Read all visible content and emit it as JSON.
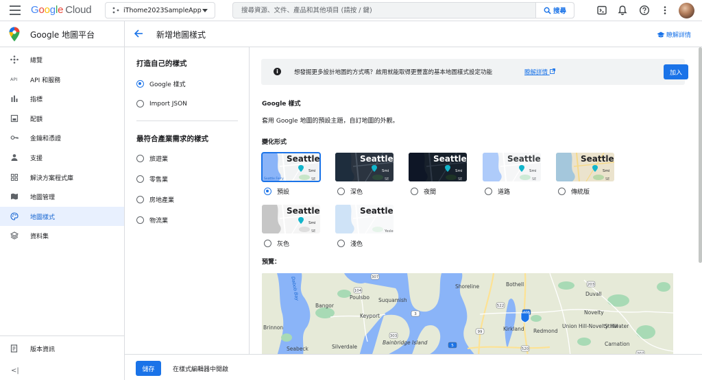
{
  "topbar": {
    "logo_letters": [
      "G",
      "o",
      "o",
      "g",
      "l",
      "e"
    ],
    "logo_cloud": "Cloud",
    "project_name": "iThome2023SampleApp",
    "search_placeholder": "搜尋資源、文件、產品和其他項目 (請按 / 鍵)",
    "search_button": "搜尋"
  },
  "leftnav": {
    "product_title": "Google 地圖平台",
    "items": [
      {
        "label": "總覽",
        "icon": "overview-icon"
      },
      {
        "label": "API 和服務",
        "icon": "api-icon",
        "icon_text": "API"
      },
      {
        "label": "指標",
        "icon": "metrics-icon"
      },
      {
        "label": "配額",
        "icon": "quotas-icon"
      },
      {
        "label": "金鑰和憑證",
        "icon": "key-icon"
      },
      {
        "label": "支援",
        "icon": "support-icon"
      },
      {
        "label": "解決方案程式庫",
        "icon": "library-icon"
      },
      {
        "label": "地圖管理",
        "icon": "map-icon"
      },
      {
        "label": "地圖樣式",
        "icon": "palette-icon"
      },
      {
        "label": "資料集",
        "icon": "dataset-icon"
      }
    ],
    "active_index": 8,
    "release_notes": "版本資訊",
    "collapse": "<|"
  },
  "subheader": {
    "title": "新增地圖樣式",
    "learn_more": "瞭解詳情"
  },
  "style_panel": {
    "section1_title": "打造自己的樣式",
    "section1_options": [
      "Google 樣式",
      "Import JSON"
    ],
    "section1_selected": 0,
    "section2_title": "最符合產業需求的樣式",
    "section2_options": [
      "旅遊業",
      "零售業",
      "房地產業",
      "物流業"
    ]
  },
  "content": {
    "banner_text": "想發掘更多設計地圖的方式嗎？啟用就能取得更豐富的基本地圖樣式設定功能",
    "banner_link": "瞭解詳情",
    "banner_button": "加入",
    "google_style_title": "Google 樣式",
    "google_style_desc": "套用 Google 地圖的預設主題，自訂地圖的外觀。",
    "variants_title": "變化形式",
    "variants": [
      {
        "label": "預設",
        "theme": "default"
      },
      {
        "label": "深色",
        "theme": "dark"
      },
      {
        "label": "夜間",
        "theme": "night"
      },
      {
        "label": "道路",
        "theme": "road"
      },
      {
        "label": "傳統版",
        "theme": "retro"
      },
      {
        "label": "灰色",
        "theme": "gray"
      },
      {
        "label": "淺色",
        "theme": "light"
      }
    ],
    "selected_variant": 0,
    "thumb_city": "Seattle",
    "thumb_road": "SE",
    "thumb_road_alt": "Yesler Wy",
    "thumb_ferry": "Seattle Ferry",
    "thumb_smith": "Smi",
    "preview_title": "預覽：",
    "map_labels": [
      "Shoreline",
      "Bothell",
      "Poulsbo",
      "Suquamish",
      "Bangor",
      "Keyport",
      "Kirkland",
      "Redmond",
      "Union Hill-Novelty Hill",
      "Novelty",
      "Duvall",
      "Stillwater",
      "Carnation",
      "Brinnon",
      "Seabeck",
      "Silverdale",
      "Bainbridge Island",
      "Dabob Bay"
    ],
    "route_numbers": [
      "307",
      "104",
      "3",
      "303",
      "522",
      "203",
      "405",
      "99",
      "520",
      "202",
      "5"
    ]
  },
  "footer": {
    "save": "儲存",
    "open_in_editor": "在樣式編輯器中開啟"
  },
  "colors": {
    "accent": "#1a73e8",
    "active_nav_bg": "#e8f0fe",
    "border": "#dadce0"
  }
}
